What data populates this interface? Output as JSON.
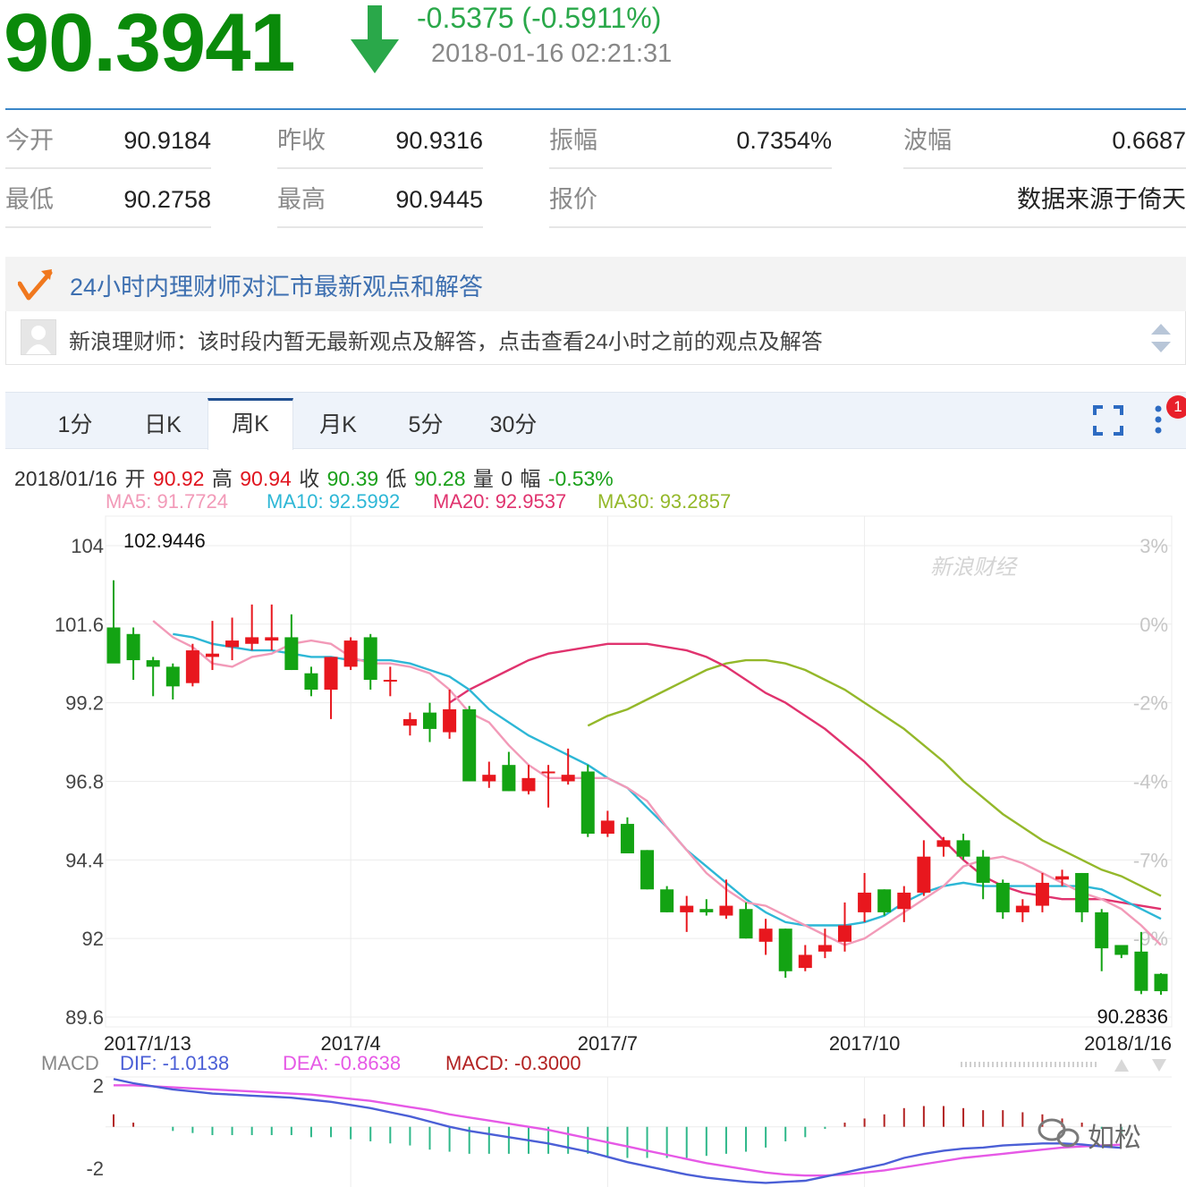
{
  "header": {
    "price": "90.3941",
    "change": "-0.5375 (-0.5911%)",
    "time": "2018-01-16 02:21:31",
    "down_color": "#0a8a0a"
  },
  "quote": {
    "open_label": "今开",
    "open": "90.9184",
    "prevclose_label": "昨收",
    "prevclose": "90.9316",
    "amplitude_label": "振幅",
    "amplitude": "0.7354%",
    "wave_label": "波幅",
    "wave": "0.6687",
    "low_label": "最低",
    "low": "90.2758",
    "high_label": "最高",
    "high": "90.9445",
    "quote_label": "报价",
    "source": "数据来源于倚天"
  },
  "advisor": {
    "title": "24小时内理财师对汇市最新观点和解答",
    "message": "新浪理财师：该时段内暂无最新观点及解答，点击查看24小时之前的观点及解答"
  },
  "tabs": [
    "1分",
    "日K",
    "周K",
    "月K",
    "5分",
    "30分"
  ],
  "active_tab": 2,
  "badge": "1",
  "info": {
    "date": "2018/01/16",
    "open_label": "开",
    "open": "90.92",
    "high_label": "高",
    "high": "90.94",
    "close_label": "收",
    "close": "90.39",
    "low_label": "低",
    "low": "90.28",
    "vol_label": "量",
    "vol": "0",
    "amp_label": "幅",
    "amp": "-0.53%"
  },
  "ma": {
    "ma5": "MA5: 91.7724",
    "ma10": "MA10: 92.5992",
    "ma20": "MA20: 92.9537",
    "ma30": "MA30: 93.2857",
    "ma5_color": "#f29ab8",
    "ma10_color": "#2db7d6",
    "ma20_color": "#e0336e",
    "ma30_color": "#94b82a"
  },
  "macd_labels": {
    "title": "MACD",
    "dif": "DIF: -1.0138",
    "dea": "DEA: -0.8638",
    "macd": "MACD: -0.3000",
    "dif_color": "#4b5fd6",
    "dea_color": "#e659e6",
    "macd_color": "#b22222"
  },
  "watermark": "新浪财经",
  "logo_text": "如松",
  "chart_data": {
    "type": "candlestick",
    "y_ticks": [
      "104",
      "101.6",
      "99.2",
      "96.8",
      "94.4",
      "92",
      "89.6"
    ],
    "y_tick_values": [
      104,
      101.6,
      99.2,
      96.8,
      94.4,
      92,
      89.6
    ],
    "pct_ticks": [
      "3%",
      "0%",
      "-2%",
      "-4%",
      "-7%",
      "-9%"
    ],
    "x_ticks": [
      "2017/1/13",
      "2017/4",
      "2017/7",
      "2017/10",
      "2018/1/16"
    ],
    "x_tick_index": [
      0,
      12,
      25,
      38,
      52
    ],
    "max_label": "102.9446",
    "min_label": "90.2836",
    "up_color": "#e8171e",
    "down_color": "#13a313",
    "candles": [
      {
        "o": 101.5,
        "h": 102.94,
        "l": 100.5,
        "c": 100.4
      },
      {
        "o": 101.3,
        "h": 101.5,
        "l": 99.9,
        "c": 100.5
      },
      {
        "o": 100.5,
        "h": 100.6,
        "l": 99.4,
        "c": 100.3
      },
      {
        "o": 100.3,
        "h": 100.4,
        "l": 99.3,
        "c": 99.7
      },
      {
        "o": 99.8,
        "h": 101.0,
        "l": 99.7,
        "c": 100.8
      },
      {
        "o": 100.6,
        "h": 101.7,
        "l": 100.2,
        "c": 100.7
      },
      {
        "o": 100.9,
        "h": 101.8,
        "l": 100.5,
        "c": 101.1
      },
      {
        "o": 101.0,
        "h": 102.2,
        "l": 100.8,
        "c": 101.2
      },
      {
        "o": 101.1,
        "h": 102.2,
        "l": 100.8,
        "c": 101.2
      },
      {
        "o": 101.2,
        "h": 101.9,
        "l": 100.2,
        "c": 100.2
      },
      {
        "o": 100.1,
        "h": 100.3,
        "l": 99.4,
        "c": 99.6
      },
      {
        "o": 99.6,
        "h": 100.6,
        "l": 98.7,
        "c": 100.6
      },
      {
        "o": 100.3,
        "h": 101.2,
        "l": 100.2,
        "c": 101.1
      },
      {
        "o": 101.2,
        "h": 101.3,
        "l": 99.6,
        "c": 99.9
      },
      {
        "o": 99.9,
        "h": 100.3,
        "l": 99.4,
        "c": 99.9
      },
      {
        "o": 98.5,
        "h": 98.9,
        "l": 98.2,
        "c": 98.7
      },
      {
        "o": 98.9,
        "h": 99.2,
        "l": 98.0,
        "c": 98.4
      },
      {
        "o": 98.3,
        "h": 99.6,
        "l": 98.1,
        "c": 99.0
      },
      {
        "o": 99.0,
        "h": 99.1,
        "l": 96.8,
        "c": 96.8
      },
      {
        "o": 96.8,
        "h": 97.4,
        "l": 96.6,
        "c": 97.0
      },
      {
        "o": 97.3,
        "h": 97.7,
        "l": 96.5,
        "c": 96.5
      },
      {
        "o": 96.5,
        "h": 97.3,
        "l": 96.4,
        "c": 96.9
      },
      {
        "o": 97.1,
        "h": 97.3,
        "l": 96.0,
        "c": 97.1
      },
      {
        "o": 96.8,
        "h": 97.8,
        "l": 96.7,
        "c": 97.0
      },
      {
        "o": 97.1,
        "h": 97.3,
        "l": 95.1,
        "c": 95.2
      },
      {
        "o": 95.2,
        "h": 95.9,
        "l": 95.1,
        "c": 95.6
      },
      {
        "o": 95.5,
        "h": 95.7,
        "l": 94.6,
        "c": 94.6
      },
      {
        "o": 94.7,
        "h": 94.7,
        "l": 93.5,
        "c": 93.5
      },
      {
        "o": 93.5,
        "h": 93.6,
        "l": 92.8,
        "c": 92.8
      },
      {
        "o": 92.8,
        "h": 93.3,
        "l": 92.2,
        "c": 93.0
      },
      {
        "o": 92.9,
        "h": 93.2,
        "l": 92.7,
        "c": 92.8
      },
      {
        "o": 92.7,
        "h": 93.8,
        "l": 92.6,
        "c": 93.0
      },
      {
        "o": 92.9,
        "h": 93.1,
        "l": 92.0,
        "c": 92.0
      },
      {
        "o": 91.9,
        "h": 92.6,
        "l": 91.5,
        "c": 92.3
      },
      {
        "o": 92.3,
        "h": 92.3,
        "l": 90.8,
        "c": 91.0
      },
      {
        "o": 91.1,
        "h": 91.8,
        "l": 91.0,
        "c": 91.5
      },
      {
        "o": 91.6,
        "h": 92.3,
        "l": 91.4,
        "c": 91.8
      },
      {
        "o": 91.9,
        "h": 93.1,
        "l": 91.6,
        "c": 92.4
      },
      {
        "o": 92.8,
        "h": 94.0,
        "l": 92.5,
        "c": 93.4
      },
      {
        "o": 93.5,
        "h": 93.5,
        "l": 92.7,
        "c": 92.8
      },
      {
        "o": 92.9,
        "h": 93.6,
        "l": 92.5,
        "c": 93.4
      },
      {
        "o": 93.4,
        "h": 95.0,
        "l": 93.3,
        "c": 94.5
      },
      {
        "o": 94.8,
        "h": 95.1,
        "l": 94.5,
        "c": 95.0
      },
      {
        "o": 95.0,
        "h": 95.2,
        "l": 94.4,
        "c": 94.5
      },
      {
        "o": 94.5,
        "h": 94.7,
        "l": 93.2,
        "c": 93.7
      },
      {
        "o": 93.7,
        "h": 93.8,
        "l": 92.6,
        "c": 92.8
      },
      {
        "o": 92.8,
        "h": 93.2,
        "l": 92.5,
        "c": 93.0
      },
      {
        "o": 93.0,
        "h": 94.0,
        "l": 92.8,
        "c": 93.7
      },
      {
        "o": 93.8,
        "h": 94.1,
        "l": 93.6,
        "c": 93.9
      },
      {
        "o": 94.0,
        "h": 94.0,
        "l": 92.5,
        "c": 92.8
      },
      {
        "o": 92.8,
        "h": 92.9,
        "l": 91.0,
        "c": 91.7
      },
      {
        "o": 91.8,
        "h": 91.8,
        "l": 91.4,
        "c": 91.5
      },
      {
        "o": 91.6,
        "h": 92.2,
        "l": 90.3,
        "c": 90.4
      },
      {
        "o": 90.92,
        "h": 90.94,
        "l": 90.28,
        "c": 90.39
      }
    ],
    "ma5": [
      101.7,
      101.2,
      100.9,
      100.4,
      100.3,
      100.6,
      100.7,
      101.0,
      101.1,
      101.0,
      100.6,
      100.4,
      100.4,
      100.3,
      100.1,
      99.6,
      98.9,
      98.6,
      97.9,
      97.3,
      96.9,
      96.9,
      96.9,
      96.9,
      96.6,
      96.2,
      95.4,
      94.7,
      94.0,
      93.5,
      93.1,
      93.0,
      92.7,
      92.4,
      92.1,
      91.8,
      92.0,
      92.4,
      92.8,
      93.2,
      93.6,
      94.2,
      94.4,
      94.5,
      94.3,
      94.0,
      93.7,
      93.4,
      93.2,
      92.9,
      92.4,
      91.8
    ],
    "ma10": [
      101.3,
      101.2,
      101.0,
      100.9,
      100.8,
      100.8,
      100.7,
      100.6,
      100.6,
      100.5,
      100.5,
      100.5,
      100.4,
      100.2,
      100.0,
      99.6,
      99.0,
      98.6,
      98.2,
      97.9,
      97.6,
      97.3,
      96.9,
      96.6,
      96.0,
      95.4,
      94.7,
      94.2,
      93.7,
      93.2,
      92.8,
      92.5,
      92.4,
      92.4,
      92.4,
      92.5,
      92.7,
      93.1,
      93.4,
      93.6,
      93.7,
      93.6,
      93.6,
      93.6,
      93.6,
      93.6,
      93.6,
      93.5,
      93.2,
      92.9,
      92.6
    ],
    "ma20": [
      99.2,
      99.6,
      99.9,
      100.2,
      100.5,
      100.7,
      100.8,
      100.9,
      101.0,
      101.0,
      101.0,
      100.9,
      100.8,
      100.6,
      100.3,
      99.9,
      99.5,
      99.2,
      98.8,
      98.4,
      97.9,
      97.4,
      96.8,
      96.2,
      95.6,
      95.0,
      94.4,
      93.9,
      93.6,
      93.4,
      93.3,
      93.2,
      93.2,
      93.2,
      93.1,
      93.0,
      92.9
    ],
    "ma30": [
      98.5,
      98.8,
      99.0,
      99.3,
      99.6,
      99.9,
      100.2,
      100.4,
      100.5,
      100.5,
      100.4,
      100.2,
      99.9,
      99.6,
      99.2,
      98.8,
      98.4,
      97.9,
      97.4,
      96.8,
      96.3,
      95.8,
      95.4,
      95.0,
      94.7,
      94.4,
      94.1,
      93.9,
      93.6,
      93.3
    ],
    "macd": {
      "y_ticks": [
        "2",
        "-2"
      ],
      "y_tick_values": [
        2,
        -2
      ],
      "dif": [
        2.3,
        2.1,
        1.95,
        1.8,
        1.7,
        1.6,
        1.55,
        1.5,
        1.45,
        1.4,
        1.3,
        1.2,
        1.05,
        0.9,
        0.7,
        0.5,
        0.25,
        0.0,
        -0.2,
        -0.35,
        -0.5,
        -0.65,
        -0.8,
        -1.0,
        -1.2,
        -1.45,
        -1.7,
        -1.9,
        -2.1,
        -2.3,
        -2.45,
        -2.55,
        -2.65,
        -2.7,
        -2.65,
        -2.6,
        -2.4,
        -2.2,
        -2.0,
        -1.8,
        -1.5,
        -1.3,
        -1.15,
        -1.05,
        -1.0,
        -0.9,
        -0.85,
        -0.8,
        -0.8,
        -0.85,
        -0.95,
        -1.0138
      ],
      "dea": [
        2.0,
        2.0,
        1.95,
        1.9,
        1.85,
        1.8,
        1.75,
        1.7,
        1.65,
        1.6,
        1.55,
        1.45,
        1.35,
        1.25,
        1.1,
        0.95,
        0.8,
        0.6,
        0.45,
        0.3,
        0.15,
        0.0,
        -0.15,
        -0.35,
        -0.55,
        -0.75,
        -0.95,
        -1.15,
        -1.35,
        -1.55,
        -1.75,
        -1.9,
        -2.05,
        -2.2,
        -2.3,
        -2.35,
        -2.35,
        -2.3,
        -2.2,
        -2.1,
        -1.95,
        -1.8,
        -1.65,
        -1.5,
        -1.4,
        -1.3,
        -1.2,
        -1.1,
        -1.0,
        -0.95,
        -0.9,
        -0.8638
      ],
      "hist": [
        0.6,
        0.2,
        0.0,
        -0.2,
        -0.3,
        -0.4,
        -0.4,
        -0.4,
        -0.4,
        -0.4,
        -0.5,
        -0.5,
        -0.6,
        -0.7,
        -0.8,
        -0.9,
        -1.1,
        -1.2,
        -1.3,
        -1.3,
        -1.3,
        -1.3,
        -1.3,
        -1.3,
        -1.3,
        -1.4,
        -1.5,
        -1.5,
        -1.5,
        -1.5,
        -1.4,
        -1.3,
        -1.2,
        -1.0,
        -0.7,
        -0.5,
        -0.1,
        0.2,
        0.4,
        0.6,
        0.9,
        1.0,
        1.0,
        0.9,
        0.8,
        0.8,
        0.7,
        0.6,
        0.4,
        0.2,
        -0.1,
        -0.3
      ]
    }
  }
}
